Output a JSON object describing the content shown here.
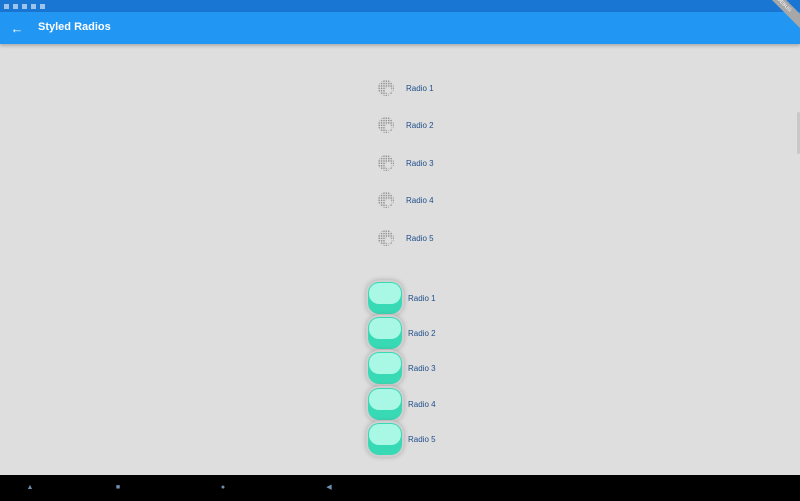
{
  "app_bar": {
    "title": "Styled Radios",
    "back_icon": "arrow-left-icon"
  },
  "debug_banner": "DEBUG",
  "group_a": [
    {
      "label": "Radio 1"
    },
    {
      "label": "Radio 2"
    },
    {
      "label": "Radio 3"
    },
    {
      "label": "Radio 4"
    },
    {
      "label": "Radio 5"
    }
  ],
  "group_b": [
    {
      "label": "Radio 1"
    },
    {
      "label": "Radio 2"
    },
    {
      "label": "Radio 3"
    },
    {
      "label": "Radio 4"
    },
    {
      "label": "Radio 5"
    }
  ],
  "colors": {
    "app_bar": "#2196f3",
    "status_bar": "#1976d2",
    "background": "#dedede",
    "radio_top": "#a9f7e5",
    "radio_base": "#38d9b5",
    "label": "#1f4e8a"
  },
  "nav_icons": [
    "back-icon",
    "home-icon",
    "recents-icon",
    "up-icon"
  ]
}
